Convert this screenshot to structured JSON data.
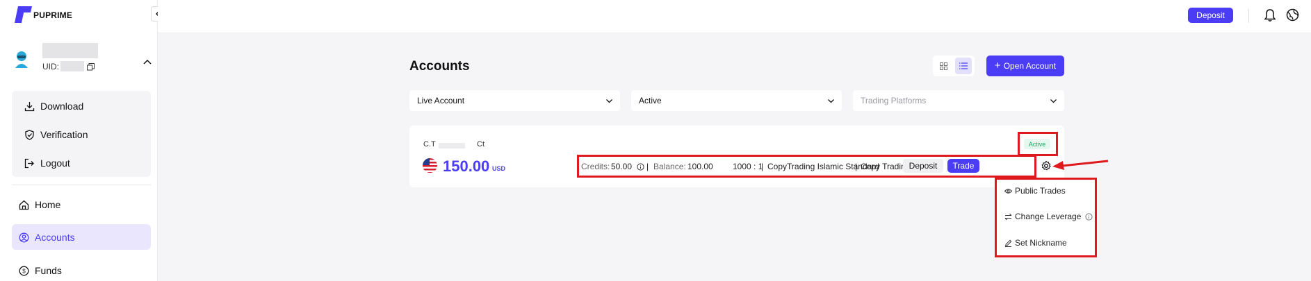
{
  "brand": {
    "name": "PUPRIME"
  },
  "user": {
    "uid_label": "UID:"
  },
  "sidebar": {
    "menu": [
      {
        "label": "Download",
        "icon": "download-icon"
      },
      {
        "label": "Verification",
        "icon": "shield-check-icon"
      },
      {
        "label": "Logout",
        "icon": "logout-icon"
      }
    ],
    "nav": [
      {
        "label": "Home",
        "icon": "home-icon",
        "active": false
      },
      {
        "label": "Accounts",
        "icon": "accounts-icon",
        "active": true
      },
      {
        "label": "Funds",
        "icon": "funds-icon",
        "active": false
      }
    ]
  },
  "topbar": {
    "deposit_label": "Deposit"
  },
  "page": {
    "title": "Accounts",
    "open_account_label": "Open Account"
  },
  "filters": {
    "account_type": "Live Account",
    "status": "Active",
    "platforms_placeholder": "Trading Platforms"
  },
  "account": {
    "name_prefix": "C.T",
    "name_suffix": "Ct",
    "amount": "150.00",
    "currency": "USD",
    "status_badge": "Active",
    "credits_label": "Credits:",
    "credits_value": "50.00",
    "balance_label": "Balance:",
    "balance_value": "100.00",
    "leverage": "1000 : 1",
    "account_type": "CopyTrading Islamic Standard",
    "platform": "Copy Trading",
    "deposit_label": "Deposit",
    "trade_label": "Trade"
  },
  "settings_menu": {
    "items": [
      {
        "label": "Public Trades",
        "icon": "eye-icon"
      },
      {
        "label": "Change Leverage",
        "icon": "swap-icon"
      },
      {
        "label": "Set Nickname",
        "icon": "pen-icon"
      }
    ]
  },
  "colors": {
    "primary": "#4b3df6",
    "active_nav_bg": "#e9e6fd",
    "active_badge_bg": "#e5f8ef",
    "active_badge_text": "#1ea866",
    "highlight": "#e0191e"
  }
}
